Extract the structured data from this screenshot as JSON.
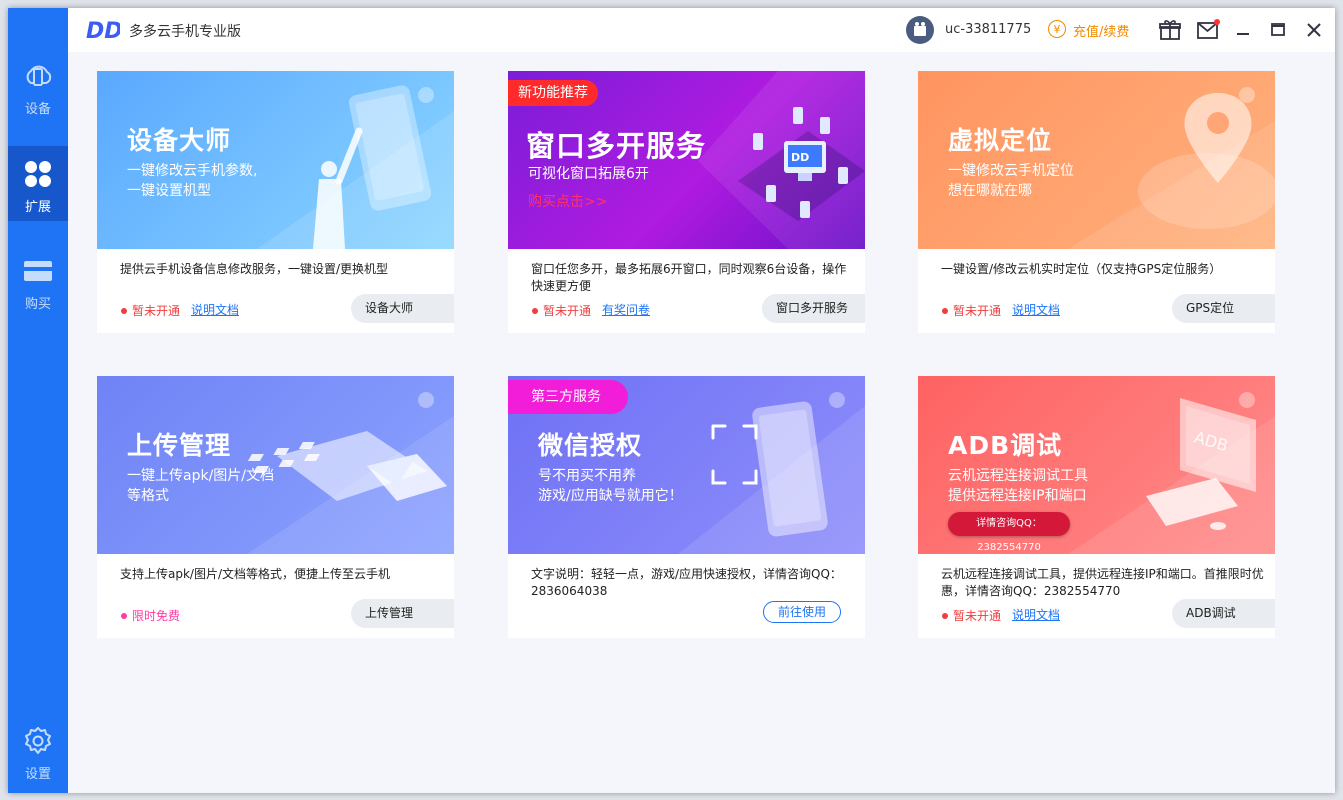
{
  "app": {
    "title": "多多云手机专业版",
    "logo_text": "DD"
  },
  "header": {
    "user_id": "uc-33811775",
    "recharge_label": "充值/续费",
    "coin_symbol": "¥"
  },
  "sidebar": {
    "items": [
      {
        "label": "设备",
        "icon": "cloud-phone-icon"
      },
      {
        "label": "扩展",
        "icon": "grid-icon"
      },
      {
        "label": "购买",
        "icon": "card-icon"
      },
      {
        "label": "设置",
        "icon": "gear-icon"
      }
    ]
  },
  "cards": [
    {
      "banner_title": "设备大师",
      "banner_sub1": "一键修改云手机参数,",
      "banner_sub2": "一键设置机型",
      "description": "提供云手机设备信息修改服务，一键设置/更换机型",
      "status": "暂未开通",
      "link": "说明文档",
      "button": "设备大师"
    },
    {
      "tag": "新功能推荐",
      "banner_title": "窗口多开服务",
      "banner_sub1": "可视化窗口拓展6开",
      "banner_buy": "购买点击>>",
      "description": "窗口任您多开，最多拓展6开窗口，同时观察6台设备，操作快速更方便",
      "status": "暂未开通",
      "link": "有奖问卷",
      "button": "窗口多开服务"
    },
    {
      "banner_title": "虚拟定位",
      "banner_sub1": "一键修改云手机定位",
      "banner_sub2": "想在哪就在哪",
      "description": "一键设置/修改云机实时定位（仅支持GPS定位服务）",
      "status": "暂未开通",
      "link": "说明文档",
      "button": "GPS定位"
    },
    {
      "banner_title": "上传管理",
      "banner_sub1": "一键上传apk/图片/文档",
      "banner_sub2": "等格式",
      "description": "支持上传apk/图片/文档等格式，便捷上传至云手机",
      "status": "限时免费",
      "button": "上传管理"
    },
    {
      "tag": "第三方服务",
      "banner_title": "微信授权",
      "banner_sub1": "号不用买不用养",
      "banner_sub2": "游戏/应用缺号就用它！",
      "description": "文字说明：轻轻一点，游戏/应用快速授权，详情咨询QQ：2836064038",
      "button": "前往使用"
    },
    {
      "banner_title": "ADB调试",
      "banner_sub1": "云机远程连接调试工具",
      "banner_sub2": "提供远程连接IP和端口",
      "banner_qq": "详情咨询QQ：2382554770",
      "banner_screen_text": "ADB",
      "description": "云机远程连接调试工具，提供远程连接IP和端口。首推限时优惠，详情咨询QQ：2382554770",
      "status": "暂未开通",
      "link": "说明文档",
      "button": "ADB调试"
    }
  ]
}
